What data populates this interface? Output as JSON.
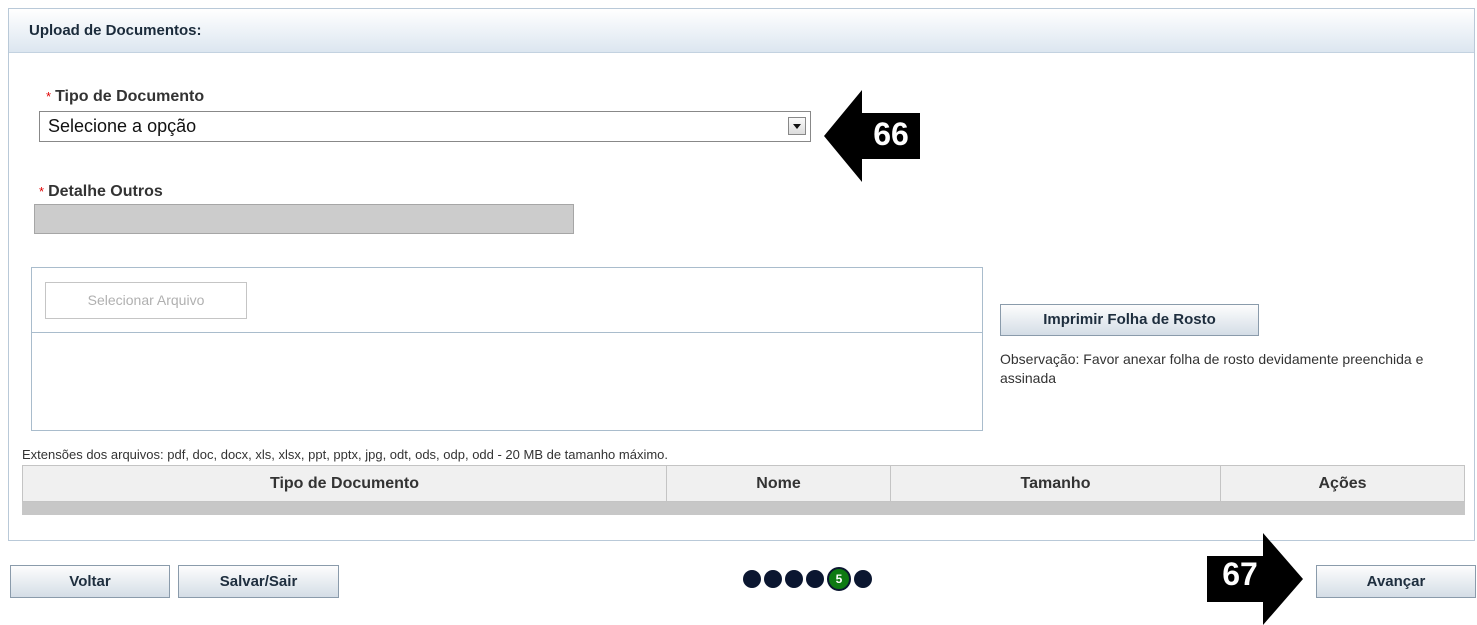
{
  "panel": {
    "title": "Upload de Documentos:"
  },
  "form": {
    "required_mark": "*",
    "tipo_label": "Tipo de Documento",
    "tipo_value": "Selecione a opção",
    "detalhe_label": "Detalhe Outros",
    "detalhe_value": ""
  },
  "upload": {
    "select_file_label": "Selecionar Arquivo"
  },
  "side": {
    "print_button": "Imprimir Folha de Rosto",
    "note": "Observação: Favor anexar folha de rosto devidamente preenchida e assinada"
  },
  "extensions": "Extensões dos arquivos: pdf, doc, docx, xls, xlsx, ppt, pptx, jpg, odt, ods, odp, odd - 20 MB de tamanho máximo.",
  "table": {
    "headers": [
      "Tipo de Documento",
      "Nome",
      "Tamanho",
      "Ações"
    ]
  },
  "footer": {
    "back": "Voltar",
    "save": "Salvar/Sair",
    "next": "Avançar"
  },
  "steps": {
    "current": "5"
  },
  "annotations": {
    "a66": "66",
    "a67": "67",
    "color": "#000000"
  }
}
